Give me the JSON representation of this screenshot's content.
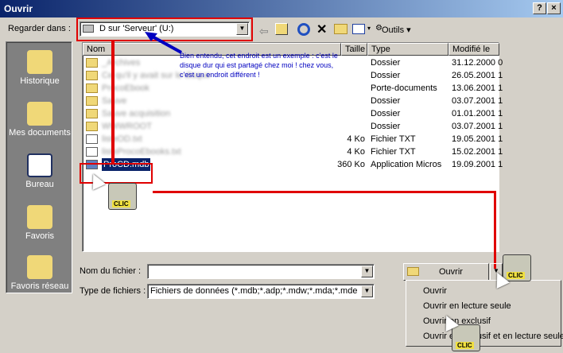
{
  "window": {
    "title": "Ouvrir",
    "help_btn": "?",
    "close_btn": "×"
  },
  "lookin": {
    "label": "Regarder dans :",
    "value": "D sur 'Serveur' (U:)"
  },
  "toolbar": {
    "outils": "Outils ▾"
  },
  "callout": {
    "text": "Bien entendu, cet endroit est un exemple : c'est le disque dur qui est partagé chez moi ! chez vous, c'est un endroit différent !"
  },
  "places": [
    {
      "label": "Historique"
    },
    {
      "label": "Mes documents"
    },
    {
      "label": "Bureau"
    },
    {
      "label": "Favoris"
    },
    {
      "label": "Favoris réseau"
    }
  ],
  "columns": {
    "name": "Nom",
    "size": "Taille",
    "type": "Type",
    "modified": "Modifié le"
  },
  "files": [
    {
      "name": "_Archives",
      "size": "",
      "type": "Dossier",
      "date": "31.12.2000 0",
      "kind": "folder"
    },
    {
      "name": "Ce qu'il y avait sur le disque",
      "size": "",
      "type": "Dossier",
      "date": "26.05.2001 1",
      "kind": "folder"
    },
    {
      "name": "ProcoEbook",
      "size": "",
      "type": "Porte-documents",
      "date": "13.06.2001 1",
      "kind": "folder"
    },
    {
      "name": "Sauve",
      "size": "",
      "type": "Dossier",
      "date": "03.07.2001 1",
      "kind": "folder"
    },
    {
      "name": "Sauve acquisition",
      "size": "",
      "type": "Dossier",
      "date": "01.01.2001 1",
      "kind": "folder"
    },
    {
      "name": "WWWROOT",
      "size": "",
      "type": "Dossier",
      "date": "03.07.2001 1",
      "kind": "folder"
    },
    {
      "name": "listeOD.txt",
      "size": "4 Ko",
      "type": "Fichier TXT",
      "date": "19.05.2001 1",
      "kind": "doc"
    },
    {
      "name": "listeProcoEbooks.txt",
      "size": "4 Ko",
      "type": "Fichier TXT",
      "date": "15.02.2001 1",
      "kind": "doc"
    },
    {
      "name": "ProCD.mdb",
      "size": "360 Ko",
      "type": "Application Micros",
      "date": "19.09.2001 1",
      "kind": "mdb"
    }
  ],
  "filename": {
    "label": "Nom du fichier :",
    "value": ""
  },
  "filetype": {
    "label": "Type de fichiers :",
    "value": "Fichiers de données (*.mdb;*.adp;*.mdw;*.mda;*.mde"
  },
  "open_button": {
    "label": "Ouvrir"
  },
  "menu": [
    "Ouvrir",
    "Ouvrir en lecture seule",
    "Ouvrir en exclusif",
    "Ouvrir en exclusif et en lecture seule"
  ],
  "clic": "CLIC"
}
